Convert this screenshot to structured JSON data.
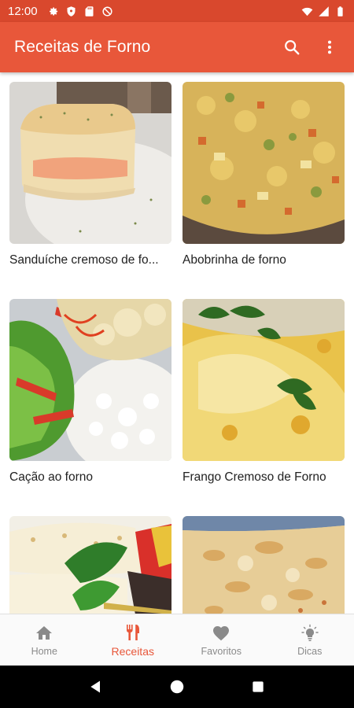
{
  "status_bar": {
    "time": "12:00",
    "left_icons": [
      "gear-icon",
      "shield-icon",
      "sd-card-icon",
      "no-sync-icon"
    ],
    "right_icons": [
      "wifi-icon",
      "signal-icon",
      "battery-icon"
    ]
  },
  "app_bar": {
    "title": "Receitas de Forno",
    "actions": [
      "search-icon",
      "more-vert-icon"
    ],
    "color": "#e8573a"
  },
  "recipes": [
    {
      "title": "Sanduíche cremoso de fo...",
      "image": "creamy-sandwich"
    },
    {
      "title": "Abobrinha de forno",
      "image": "zucchini-bake"
    },
    {
      "title": "Cação ao forno",
      "image": "fish-with-rice-salad"
    },
    {
      "title": "Frango Cremoso de Forno",
      "image": "creamy-chicken"
    },
    {
      "title": "",
      "image": "fish-fillet-with-veggies"
    },
    {
      "title": "",
      "image": "gratin"
    }
  ],
  "bottom_nav": {
    "items": [
      {
        "label": "Home",
        "icon": "home-icon",
        "active": false
      },
      {
        "label": "Receitas",
        "icon": "cutlery-icon",
        "active": true
      },
      {
        "label": "Favoritos",
        "icon": "heart-icon",
        "active": false
      },
      {
        "label": "Dicas",
        "icon": "lightbulb-icon",
        "active": false
      }
    ],
    "active_color": "#e8573a",
    "inactive_color": "#8a8a8a"
  },
  "system_nav": [
    "back-icon",
    "home-circle-icon",
    "recents-icon"
  ]
}
